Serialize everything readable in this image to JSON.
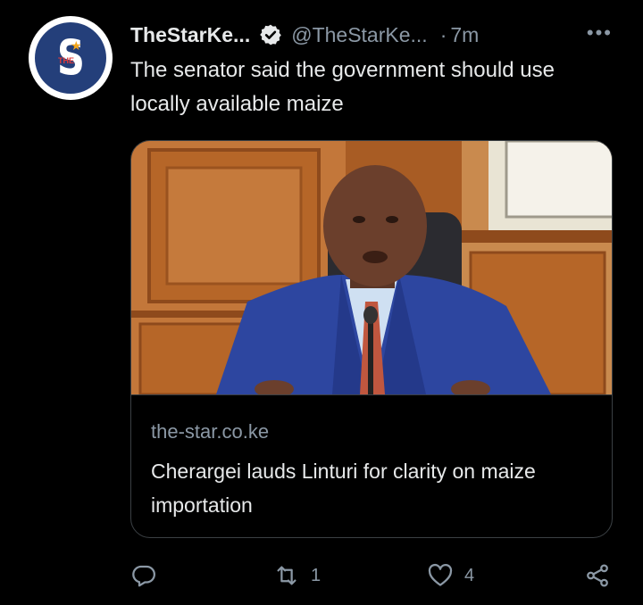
{
  "tweet": {
    "author_name": "TheStarKe...",
    "handle": "@TheStarKe...",
    "separator": "·",
    "time": "7m",
    "more": "•••",
    "text": "The senator said the government should use locally available maize",
    "avatar": {
      "letter": "S",
      "small_text": "THE"
    }
  },
  "card": {
    "domain": "the-star.co.ke",
    "title": "Cherargei lauds Linturi for clarity on maize importation"
  },
  "actions": {
    "reply_count": "",
    "retweet_count": "1",
    "like_count": "4"
  },
  "icons": [
    "verified-badge-icon",
    "more-icon",
    "reply-icon",
    "retweet-icon",
    "like-icon",
    "share-icon"
  ],
  "colors": {
    "background": "#000000",
    "text": "#e7e9ea",
    "secondary": "#8b98a5",
    "border": "#3b4044",
    "avatar_blue": "#243f7a"
  }
}
